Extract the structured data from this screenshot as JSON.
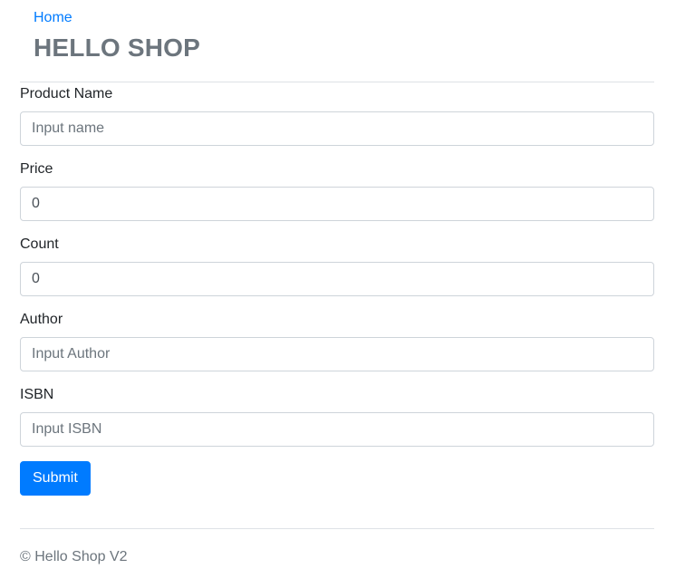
{
  "nav": {
    "home_label": "Home"
  },
  "header": {
    "title": "HELLO SHOP"
  },
  "form": {
    "fields": [
      {
        "label": "Product Name",
        "value": "",
        "placeholder": "Input name"
      },
      {
        "label": "Price",
        "value": "0",
        "placeholder": ""
      },
      {
        "label": "Count",
        "value": "0",
        "placeholder": ""
      },
      {
        "label": "Author",
        "value": "",
        "placeholder": "Input Author"
      },
      {
        "label": "ISBN",
        "value": "",
        "placeholder": "Input ISBN"
      }
    ],
    "submit_label": "Submit"
  },
  "footer": {
    "text": "© Hello Shop V2"
  },
  "colors": {
    "link": "#007bff",
    "primary_button": "#007bff",
    "title": "#6c757d",
    "muted_text": "#6c757d",
    "input_border": "#ced4da",
    "divider": "#dee2e6"
  }
}
